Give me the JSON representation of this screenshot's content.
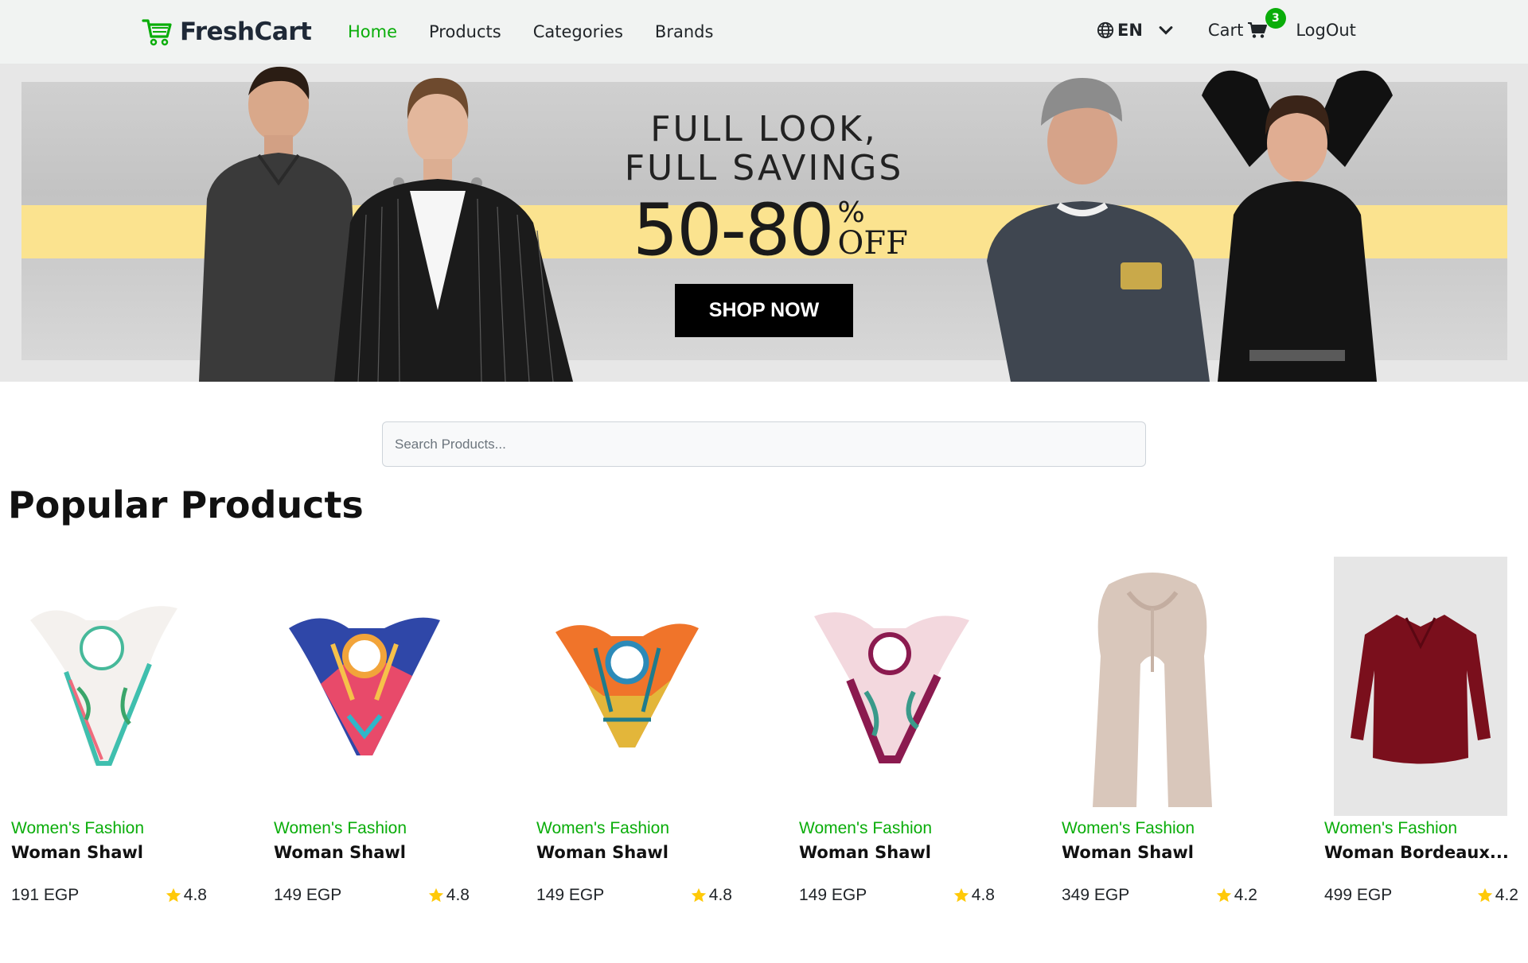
{
  "navbar": {
    "brand": "FreshCart",
    "links": [
      "Home",
      "Products",
      "Categories",
      "Brands"
    ],
    "language": "EN",
    "cart_label": "Cart",
    "cart_count": "3",
    "logout_label": "LogOut",
    "accent_color": "#0aad0a"
  },
  "hero": {
    "headline_line1": "FULL LOOK,",
    "headline_line2": "FULL SAVINGS",
    "discount": "50-80",
    "discount_percent": "%",
    "discount_off": "OFF",
    "cta": "SHOP NOW"
  },
  "search": {
    "placeholder": "Search Products..."
  },
  "section_title": "Popular Products",
  "products": [
    {
      "category": "Women's Fashion",
      "title": "Woman Shawl",
      "price": "191 EGP",
      "rating": "4.8"
    },
    {
      "category": "Women's Fashion",
      "title": "Woman Shawl",
      "price": "149 EGP",
      "rating": "4.8"
    },
    {
      "category": "Women's Fashion",
      "title": "Woman Shawl",
      "price": "149 EGP",
      "rating": "4.8"
    },
    {
      "category": "Women's Fashion",
      "title": "Woman Shawl",
      "price": "149 EGP",
      "rating": "4.8"
    },
    {
      "category": "Women's Fashion",
      "title": "Woman Shawl",
      "price": "349 EGP",
      "rating": "4.2"
    },
    {
      "category": "Women's Fashion",
      "title": "Woman Bordeaux...",
      "price": "499 EGP",
      "rating": "4.2"
    }
  ]
}
